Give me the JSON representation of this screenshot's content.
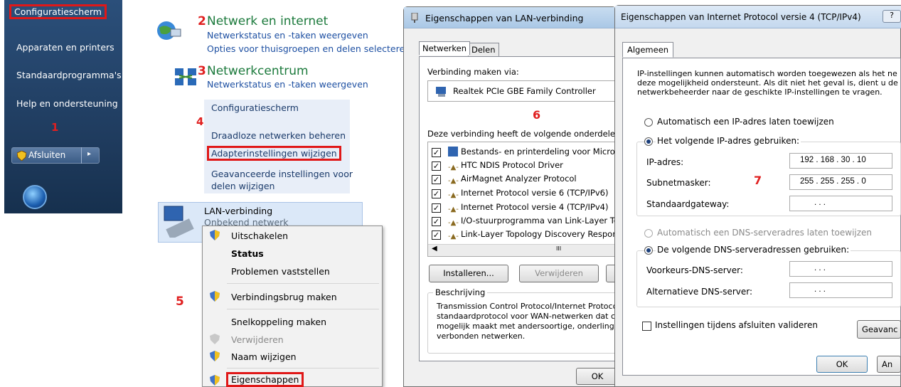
{
  "start_menu": {
    "items": [
      "Configuratiescherm",
      "Apparaten en printers",
      "Standaardprogramma's",
      "Help en ondersteuning"
    ],
    "step": "1",
    "shutdown_label": "Afsluiten"
  },
  "network_panel": {
    "step2": "2",
    "title": "Netwerk en internet",
    "links": [
      "Netwerkstatus en -taken weergeven",
      "Opties voor thuisgroepen en delen selecteren"
    ],
    "step3": "3",
    "center_title": "Netwerkcentrum",
    "center_link": "Netwerkstatus en -taken weergeven"
  },
  "sidebar": {
    "step": "4",
    "items": [
      "Configuratiescherm",
      "Draadloze netwerken beheren",
      "Adapterinstellingen wijzigen",
      "Geavanceerde instellingen voor",
      "delen wijzigen"
    ]
  },
  "lan_tile": {
    "name": "LAN-verbinding",
    "status": "Onbekend netwerk"
  },
  "context_menu": {
    "step": "5",
    "items": [
      "Uitschakelen",
      "Status",
      "Problemen vaststellen",
      "Verbindingsbrug maken",
      "Snelkoppeling maken",
      "Verwijderen",
      "Naam wijzigen",
      "Eigenschappen"
    ]
  },
  "lan_dialog": {
    "title": "Eigenschappen van LAN-verbinding",
    "tabs": [
      "Netwerken",
      "Delen"
    ],
    "connect_via_label": "Verbinding maken via:",
    "adapter": "Realtek PCIe GBE Family Controller",
    "step": "6",
    "components_label": "Deze verbinding heeft de volgende onderdelen n",
    "components": [
      "Bestands- en printerdeling voor Microso",
      "HTC NDIS Protocol Driver",
      "AirMagnet Analyzer Protocol",
      "Internet Protocol versie 6 (TCP/IPv6)",
      "Internet Protocol versie 4 (TCP/IPv4)",
      "I/O-stuurprogramma van Link-Layer Top",
      "Link-Layer Topology Discovery Respon"
    ],
    "scroll_glyph": "III",
    "install_button": "Installeren...",
    "remove_button": "Verwijderen",
    "description_label": "Beschrijving",
    "description_lines": [
      "Transmission Control Protocol/Internet Protoco",
      "standaardprotocol voor WAN-netwerken dat c",
      "mogelijk maakt met andersoortige, onderling m",
      "verbonden netwerken."
    ],
    "ok_button": "OK"
  },
  "ipv4_dialog": {
    "title": "Eigenschappen van Internet Protocol versie 4 (TCP/IPv4)",
    "tab": "Algemeen",
    "intro_lines": [
      "IP-instellingen kunnen automatisch worden toegewezen als het ne",
      "deze mogelijkheid ondersteunt. Als dit niet het geval is, dient u de",
      "netwerkbeheerder naar de geschikte IP-instellingen te vragen."
    ],
    "auto_ip": "Automatisch een IP-adres laten toewijzen",
    "manual_ip": "Het volgende IP-adres gebruiken:",
    "ip_label": "IP-adres:",
    "ip_value": "192 . 168 . 30 . 10",
    "subnet_label": "Subnetmasker:",
    "subnet_value": "255 . 255 . 255 . 0",
    "gateway_label": "Standaardgateway:",
    "empty_ip": ".    .    .",
    "step": "7",
    "auto_dns": "Automatisch een DNS-serveradres laten toewijzen",
    "manual_dns": "De volgende DNS-serveradressen gebruiken:",
    "preferred_dns_label": "Voorkeurs-DNS-server:",
    "alternate_dns_label": "Alternatieve DNS-server:",
    "validate_label": "Instellingen tijdens afsluiten valideren",
    "advanced_button": "Geavanc",
    "ok_button": "OK",
    "cancel_button": "An",
    "help_glyph": "?"
  },
  "colors": {
    "accent_red": "#e01818",
    "link_blue": "#1e50a2",
    "header_green": "#1c7a3c"
  }
}
